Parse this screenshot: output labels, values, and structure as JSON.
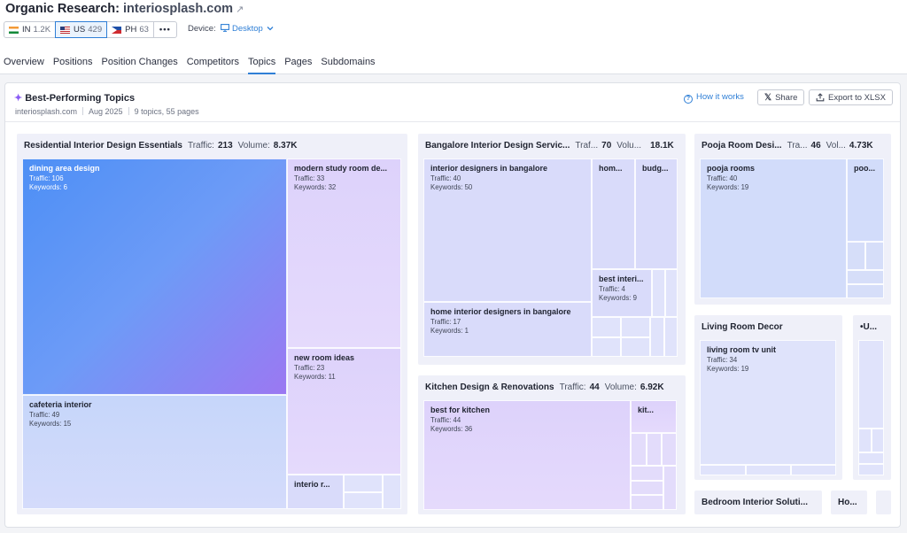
{
  "header": {
    "title_prefix": "Organic Research:",
    "domain": "interiosplash.com",
    "databases": [
      {
        "code": "IN",
        "count": "1.2K"
      },
      {
        "code": "US",
        "count": "429"
      },
      {
        "code": "PH",
        "count": "63"
      }
    ],
    "more_label": "•••",
    "device_label": "Device:",
    "device_value": "Desktop",
    "tabs": [
      "Overview",
      "Positions",
      "Position Changes",
      "Competitors",
      "Topics",
      "Pages",
      "Subdomains"
    ],
    "active_tab": "Topics"
  },
  "panel": {
    "title": "Best-Performing Topics",
    "domain": "interiosplash.com",
    "date": "Aug 2025",
    "summary": "9 topics, 55 pages",
    "how_label": "How it works",
    "share_label": "Share",
    "export_label": "Export to XLSX"
  },
  "labels": {
    "traffic": "Traffic:",
    "volume": "Volume:",
    "keywords": "Keywords:"
  },
  "groups": [
    {
      "name": "Residential Interior Design Essentials",
      "traffic_label": "Traffic:",
      "traffic": "213",
      "volume_label": "Volume:",
      "volume": "8.37K"
    },
    {
      "name": "Bangalore Interior Design Servic...",
      "traffic_label": "Traf...",
      "traffic": "70",
      "volume_label": "Volu...",
      "volume": "18.1K"
    },
    {
      "name": "Pooja Room Desi...",
      "traffic_label": "Tra...",
      "traffic": "46",
      "volume_label": "Vol...",
      "volume": "4.73K"
    },
    {
      "name": "Kitchen Design & Renovations",
      "traffic_label": "Traffic:",
      "traffic": "44",
      "volume_label": "Volume:",
      "volume": "6.92K"
    },
    {
      "name": "Living Room Decor"
    },
    {
      "name": "•U..."
    },
    {
      "name": "Bedroom Interior Soluti..."
    },
    {
      "name": "Ho..."
    }
  ],
  "tiles": [
    {
      "name": "dining area design",
      "traffic": "Traffic: 106",
      "keywords": "Keywords: 6"
    },
    {
      "name": "modern study room de...",
      "traffic": "Traffic: 33",
      "keywords": "Keywords: 32"
    },
    {
      "name": "new room ideas",
      "traffic": "Traffic: 23",
      "keywords": "Keywords: 11"
    },
    {
      "name": "cafeteria interior",
      "traffic": "Traffic: 49",
      "keywords": "Keywords: 15"
    },
    {
      "name": "interio r..."
    },
    {
      "name": "interior designers in bangalore",
      "traffic": "Traffic: 40",
      "keywords": "Keywords: 50"
    },
    {
      "name": "hom..."
    },
    {
      "name": "budg..."
    },
    {
      "name": "best interi...",
      "traffic": "Traffic: 4",
      "keywords": "Keywords: 9"
    },
    {
      "name": "home interior designers in bangalore",
      "traffic": "Traffic: 17",
      "keywords": "Keywords: 1"
    },
    {
      "name": "pooja rooms",
      "traffic": "Traffic: 40",
      "keywords": "Keywords: 19"
    },
    {
      "name": "poo..."
    },
    {
      "name": "best for kitchen",
      "traffic": "Traffic: 44",
      "keywords": "Keywords: 36"
    },
    {
      "name": "kit..."
    },
    {
      "name": "living room tv unit",
      "traffic": "Traffic: 34",
      "keywords": "Keywords: 19"
    }
  ]
}
